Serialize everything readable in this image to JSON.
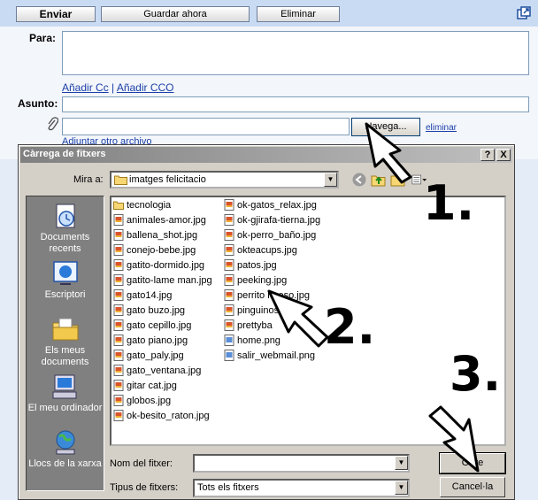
{
  "toolbar": {
    "send": "Enviar",
    "save": "Guardar ahora",
    "delete": "Eliminar"
  },
  "compose": {
    "to_label": "Para:",
    "add_cc": "Añadir Cc",
    "separator": "|",
    "add_cco": "Añadir CCO",
    "subject_label": "Asunto:",
    "browse_button": "Navega...",
    "remove_link": "eliminar",
    "attach_another": "Adjuntar otro archivo"
  },
  "dialog": {
    "title": "Càrrega de fitxers",
    "help_button": "?",
    "close_button": "X",
    "look_in_label": "Mira a:",
    "look_in_value": "imatges felicitacio",
    "places": [
      {
        "label": "Documents recents",
        "icon": "recent-documents-icon"
      },
      {
        "label": "Escriptori",
        "icon": "desktop-icon"
      },
      {
        "label": "Els meus documents",
        "icon": "my-documents-icon"
      },
      {
        "label": "El meu ordinador",
        "icon": "my-computer-icon"
      },
      {
        "label": "Llocs de la xarxa",
        "icon": "network-places-icon"
      }
    ],
    "files_col1": [
      {
        "name": "tecnologia",
        "type": "folder"
      },
      {
        "name": "animales-amor.jpg",
        "type": "jpg"
      },
      {
        "name": "ballena_shot.jpg",
        "type": "jpg"
      },
      {
        "name": "conejo-bebe.jpg",
        "type": "jpg"
      },
      {
        "name": "gatito-dormido.jpg",
        "type": "jpg"
      },
      {
        "name": "gatito-lame man.jpg",
        "type": "jpg"
      },
      {
        "name": "gato14.jpg",
        "type": "jpg"
      },
      {
        "name": "gato buzo.jpg",
        "type": "jpg"
      },
      {
        "name": "gato cepillo.jpg",
        "type": "jpg"
      },
      {
        "name": "gato piano.jpg",
        "type": "jpg"
      },
      {
        "name": "gato_paly.jpg",
        "type": "jpg"
      },
      {
        "name": "gato_ventana.jpg",
        "type": "jpg"
      },
      {
        "name": "gitar cat.jpg",
        "type": "jpg"
      },
      {
        "name": "globos.jpg",
        "type": "jpg"
      },
      {
        "name": "ok-besito_raton.jpg",
        "type": "jpg"
      }
    ],
    "files_col2": [
      {
        "name": "ok-gatos_relax.jpg",
        "type": "jpg"
      },
      {
        "name": "ok-gjirafa-tierna.jpg",
        "type": "jpg"
      },
      {
        "name": "ok-perro_baño.jpg",
        "type": "jpg"
      },
      {
        "name": "okteacups.jpg",
        "type": "jpg"
      },
      {
        "name": "patos.jpg",
        "type": "jpg"
      },
      {
        "name": "peeking.jpg",
        "type": "jpg"
      },
      {
        "name": "perrito hueso.jpg",
        "type": "jpg"
      },
      {
        "name": "pinguinos.jpg",
        "type": "jpg"
      },
      {
        "name": "prettyba",
        "type": "jpg"
      },
      {
        "name": "home.png",
        "type": "png"
      },
      {
        "name": "salir_webmail.png",
        "type": "png"
      }
    ],
    "filename_label": "Nom del fitxer:",
    "filename_value": "",
    "filetype_label": "Tipus de fitxers:",
    "filetype_value": "Tots els fitxers",
    "open_button": "Obre",
    "cancel_button": "Cancel·la"
  },
  "annotations": {
    "step1": "1.",
    "step2": "2.",
    "step3": "3."
  },
  "colors": {
    "toolbar_bg": "#c9daf3",
    "link": "#1a3fa8",
    "dialog_bg": "#d4d0c8",
    "places_bg": "#808080"
  }
}
